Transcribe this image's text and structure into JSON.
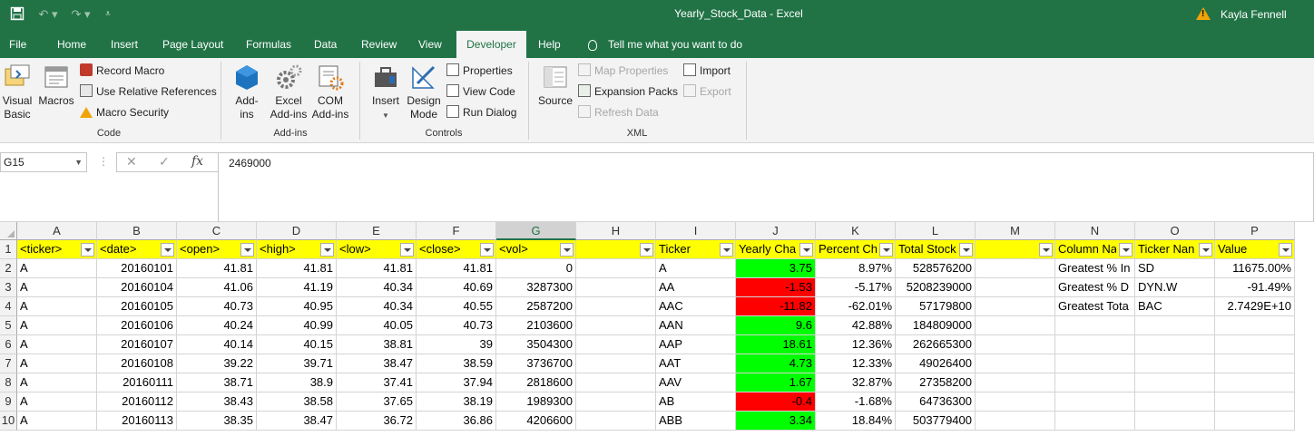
{
  "window": {
    "doc_title": "Yearly_Stock_Data  -  Excel",
    "user": "Kayla Fennell"
  },
  "tabs": [
    "File",
    "Home",
    "Insert",
    "Page Layout",
    "Formulas",
    "Data",
    "Review",
    "View",
    "Developer",
    "Help"
  ],
  "active_tab": "Developer",
  "tell_me": "Tell me what you want to do",
  "ribbon": {
    "code": {
      "label": "Code",
      "visual_basic": "Visual Basic",
      "macros": "Macros",
      "record_macro": "Record Macro",
      "relative_refs": "Use Relative References",
      "macro_security": "Macro Security"
    },
    "addins": {
      "label": "Add-ins",
      "add_ins": "Add-ins",
      "excel_add_ins": "Excel Add-ins",
      "com_add_ins": "COM Add-ins"
    },
    "controls": {
      "label": "Controls",
      "insert": "Insert",
      "design_mode": "Design Mode",
      "properties": "Properties",
      "view_code": "View Code",
      "run_dialog": "Run Dialog"
    },
    "xml": {
      "label": "XML",
      "source": "Source",
      "map_properties": "Map Properties",
      "expansion_packs": "Expansion Packs",
      "refresh_data": "Refresh Data",
      "import": "Import",
      "export": "Export"
    }
  },
  "formula_bar": {
    "name_box": "G15",
    "formula": "2469000"
  },
  "columns": [
    "A",
    "B",
    "C",
    "D",
    "E",
    "F",
    "G",
    "H",
    "I",
    "J",
    "K",
    "L",
    "M",
    "N",
    "O",
    "P"
  ],
  "selected_column": "G",
  "rows": [
    [
      "<ticker>",
      "<date>",
      "<open>",
      "<high>",
      "<low>",
      "<close>",
      "<vol>",
      "",
      "Ticker",
      "Yearly Cha",
      "Percent Ch",
      "Total Stock Volume",
      "",
      "Column Na",
      "Ticker Nan",
      "Value"
    ],
    [
      "A",
      "20160101",
      "41.81",
      "41.81",
      "41.81",
      "41.81",
      "0",
      "",
      "A",
      "3.75",
      "8.97%",
      "528576200",
      "",
      "Greatest % In",
      "SD",
      "11675.00%"
    ],
    [
      "A",
      "20160104",
      "41.06",
      "41.19",
      "40.34",
      "40.69",
      "3287300",
      "",
      "AA",
      "-1.53",
      "-5.17%",
      "5208239000",
      "",
      "Greatest % D",
      "DYN.W",
      "-91.49%"
    ],
    [
      "A",
      "20160105",
      "40.73",
      "40.95",
      "40.34",
      "40.55",
      "2587200",
      "",
      "AAC",
      "-11.82",
      "-62.01%",
      "57179800",
      "",
      "Greatest Tota",
      "BAC",
      "2.7429E+10"
    ],
    [
      "A",
      "20160106",
      "40.24",
      "40.99",
      "40.05",
      "40.73",
      "2103600",
      "",
      "AAN",
      "9.6",
      "42.88%",
      "184809000",
      "",
      "",
      "",
      ""
    ],
    [
      "A",
      "20160107",
      "40.14",
      "40.15",
      "38.81",
      "39",
      "3504300",
      "",
      "AAP",
      "18.61",
      "12.36%",
      "262665300",
      "",
      "",
      "",
      ""
    ],
    [
      "A",
      "20160108",
      "39.22",
      "39.71",
      "38.47",
      "38.59",
      "3736700",
      "",
      "AAT",
      "4.73",
      "12.33%",
      "49026400",
      "",
      "",
      "",
      ""
    ],
    [
      "A",
      "20160111",
      "38.71",
      "38.9",
      "37.41",
      "37.94",
      "2818600",
      "",
      "AAV",
      "1.67",
      "32.87%",
      "27358200",
      "",
      "",
      "",
      ""
    ],
    [
      "A",
      "20160112",
      "38.43",
      "38.58",
      "37.65",
      "38.19",
      "1989300",
      "",
      "AB",
      "-0.4",
      "-1.68%",
      "64736300",
      "",
      "",
      "",
      ""
    ],
    [
      "A",
      "20160113",
      "38.35",
      "38.47",
      "36.72",
      "36.86",
      "4206600",
      "",
      "ABB",
      "3.34",
      "18.84%",
      "503779400",
      "",
      "",
      "",
      ""
    ]
  ],
  "colors": {
    "excel_green": "#217346",
    "header_fill": "#ffff00",
    "positive_fill": "#00ff00",
    "negative_fill": "#ff0000"
  }
}
